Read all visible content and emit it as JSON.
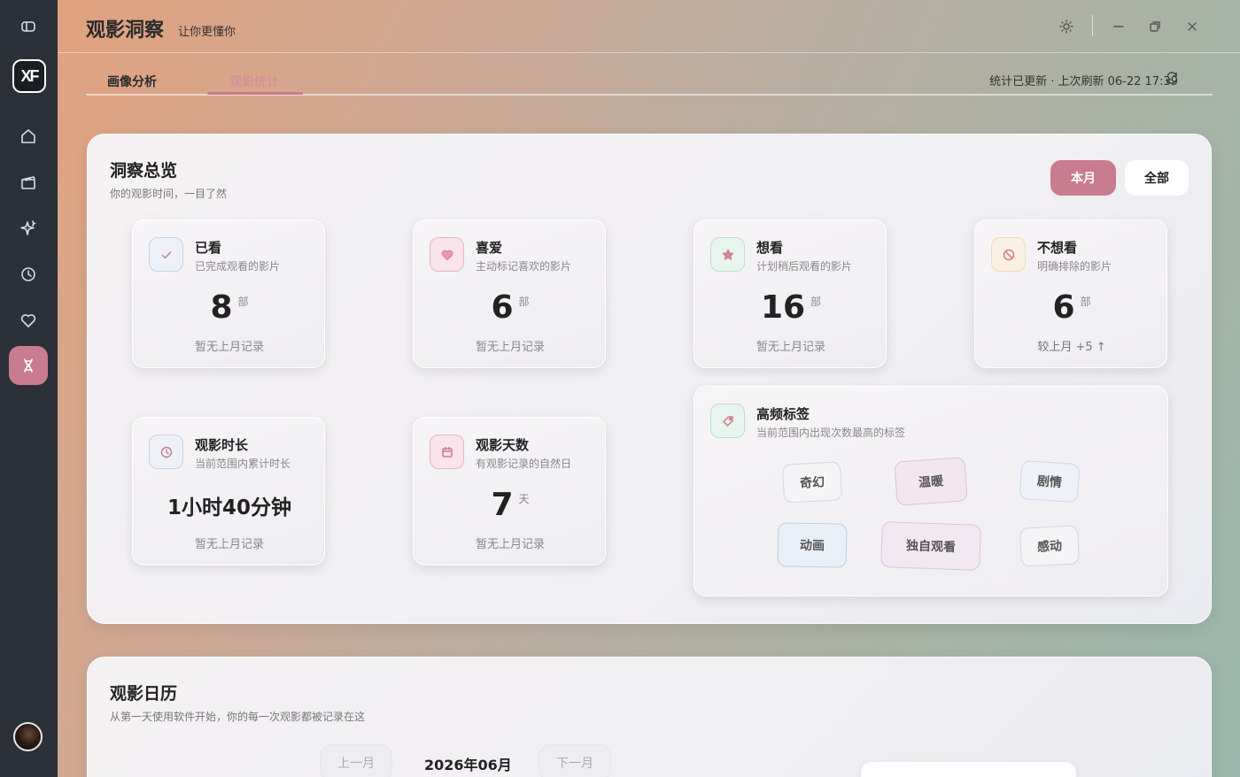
{
  "app": {
    "title": "观影洞察",
    "subtitle": "让你更懂你"
  },
  "tabs": [
    {
      "label": "画像分析"
    },
    {
      "label": "观影统计"
    }
  ],
  "status": "统计已更新 · 上次刷新 06-22 17:39",
  "overview": {
    "title": "洞察总览",
    "subtitle": "你的观影时间，一目了然",
    "range_buttons": {
      "month": "本月",
      "all": "全部"
    },
    "cards": [
      {
        "title": "已看",
        "sub": "已完成观看的影片",
        "value": "8",
        "unit": "部",
        "foot": "暂无上月记录",
        "icon": "check-icon"
      },
      {
        "title": "喜爱",
        "sub": "主动标记喜欢的影片",
        "value": "6",
        "unit": "部",
        "foot": "暂无上月记录",
        "icon": "heart-icon"
      },
      {
        "title": "想看",
        "sub": "计划稍后观看的影片",
        "value": "16",
        "unit": "部",
        "foot": "暂无上月记录",
        "icon": "star-icon"
      },
      {
        "title": "不想看",
        "sub": "明确排除的影片",
        "value": "6",
        "unit": "部",
        "foot": "较上月 +5 ↑",
        "icon": "block-icon"
      },
      {
        "title": "观影时长",
        "sub": "当前范围内累计时长",
        "value": "1小时40分钟",
        "unit": "",
        "foot": "暂无上月记录",
        "icon": "clock-icon"
      },
      {
        "title": "观影天数",
        "sub": "有观影记录的自然日",
        "value": "7",
        "unit": "天",
        "foot": "暂无上月记录",
        "icon": "calendar-icon"
      }
    ],
    "tags_card": {
      "title": "高频标签",
      "sub": "当前范围内出现次数最高的标签",
      "tags": [
        "奇幻",
        "温暖",
        "剧情",
        "动画",
        "独自观看",
        "感动"
      ]
    }
  },
  "calendar": {
    "title": "观影日历",
    "subtitle": "从第一天使用软件开始，你的每一次观影都被记录在这",
    "prev": "上一月",
    "month": "2026年06月",
    "next": "下一月"
  },
  "colors": {
    "accent": "#c97b8f",
    "sidebar": "#2b3039"
  }
}
